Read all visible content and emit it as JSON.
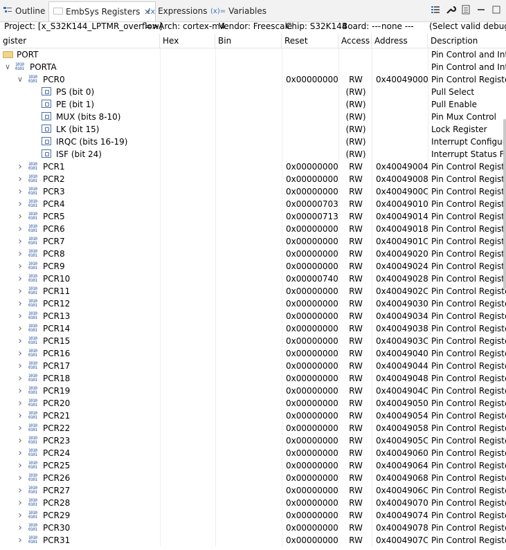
{
  "tabs": [
    {
      "label": "Outline",
      "icon": "outline-icon",
      "active": false
    },
    {
      "label": "EmbSys Registers",
      "icon": "registers-icon",
      "active": true
    },
    {
      "label": "Expressions",
      "icon": "expressions-icon",
      "active": false
    },
    {
      "label": "Variables",
      "icon": "variables-icon",
      "prefix": "(x)=",
      "active": false
    }
  ],
  "toolbar": {
    "icons": [
      "list-icon",
      "wrench-icon",
      "doc-icon",
      "minimize-icon",
      "maximize-icon"
    ]
  },
  "info": {
    "project": "Project: [x_S32K144_LPTMR_overflow]",
    "arch": "=>Arch: cortex-m4",
    "vendor": "Vendor: Freescale",
    "chip": "Chip: S32K144",
    "board": "Board: ---",
    "none": "none ---",
    "select": "(Select valid debug co"
  },
  "columns": {
    "register": "gister",
    "hex": "Hex",
    "bin": "Bin",
    "reset": "Reset",
    "access": "Access",
    "address": "Address",
    "description": "Description"
  },
  "rows": [
    {
      "kind": "group",
      "name": "PORT",
      "desc": "Pin Control and Inte",
      "level": 0
    },
    {
      "kind": "group2",
      "name": "PORTA",
      "desc": "Pin Control and Inte",
      "level": 1,
      "expanded": true
    },
    {
      "kind": "reg",
      "name": "PCR0",
      "reset": "0x00000000",
      "access": "RW",
      "addr": "0x40049000",
      "desc": "Pin Control Register",
      "expanded": true
    },
    {
      "kind": "field",
      "name": "PS (bit 0)",
      "access": "(RW)",
      "desc": "Pull Select"
    },
    {
      "kind": "field",
      "name": "PE (bit 1)",
      "access": "(RW)",
      "desc": "Pull Enable"
    },
    {
      "kind": "field",
      "name": "MUX (bits 8-10)",
      "access": "(RW)",
      "desc": "Pin Mux Control"
    },
    {
      "kind": "field",
      "name": "LK (bit 15)",
      "access": "(RW)",
      "desc": "Lock Register"
    },
    {
      "kind": "field",
      "name": "IRQC (bits 16-19)",
      "access": "(RW)",
      "desc": "Interrupt Configurat"
    },
    {
      "kind": "field",
      "name": "ISF (bit 24)",
      "access": "(RW)",
      "desc": "Interrupt Status Flag"
    },
    {
      "kind": "reg",
      "name": "PCR1",
      "reset": "0x00000000",
      "access": "RW",
      "addr": "0x40049004",
      "desc": "Pin Control Register"
    },
    {
      "kind": "reg",
      "name": "PCR2",
      "reset": "0x00000000",
      "access": "RW",
      "addr": "0x40049008",
      "desc": "Pin Control Register"
    },
    {
      "kind": "reg",
      "name": "PCR3",
      "reset": "0x00000000",
      "access": "RW",
      "addr": "0x4004900C",
      "desc": "Pin Control Register"
    },
    {
      "kind": "reg",
      "name": "PCR4",
      "reset": "0x00000703",
      "access": "RW",
      "addr": "0x40049010",
      "desc": "Pin Control Register"
    },
    {
      "kind": "reg",
      "name": "PCR5",
      "reset": "0x00000713",
      "access": "RW",
      "addr": "0x40049014",
      "desc": "Pin Control Register"
    },
    {
      "kind": "reg",
      "name": "PCR6",
      "reset": "0x00000000",
      "access": "RW",
      "addr": "0x40049018",
      "desc": "Pin Control Register"
    },
    {
      "kind": "reg",
      "name": "PCR7",
      "reset": "0x00000000",
      "access": "RW",
      "addr": "0x4004901C",
      "desc": "Pin Control Register"
    },
    {
      "kind": "reg",
      "name": "PCR8",
      "reset": "0x00000000",
      "access": "RW",
      "addr": "0x40049020",
      "desc": "Pin Control Register"
    },
    {
      "kind": "reg",
      "name": "PCR9",
      "reset": "0x00000000",
      "access": "RW",
      "addr": "0x40049024",
      "desc": "Pin Control Register"
    },
    {
      "kind": "reg",
      "name": "PCR10",
      "reset": "0x00000740",
      "access": "RW",
      "addr": "0x40049028",
      "desc": "Pin Control Register"
    },
    {
      "kind": "reg",
      "name": "PCR11",
      "reset": "0x00000000",
      "access": "RW",
      "addr": "0x4004902C",
      "desc": "Pin Control Register"
    },
    {
      "kind": "reg",
      "name": "PCR12",
      "reset": "0x00000000",
      "access": "RW",
      "addr": "0x40049030",
      "desc": "Pin Control Register"
    },
    {
      "kind": "reg",
      "name": "PCR13",
      "reset": "0x00000000",
      "access": "RW",
      "addr": "0x40049034",
      "desc": "Pin Control Register"
    },
    {
      "kind": "reg",
      "name": "PCR14",
      "reset": "0x00000000",
      "access": "RW",
      "addr": "0x40049038",
      "desc": "Pin Control Register"
    },
    {
      "kind": "reg",
      "name": "PCR15",
      "reset": "0x00000000",
      "access": "RW",
      "addr": "0x4004903C",
      "desc": "Pin Control Register"
    },
    {
      "kind": "reg",
      "name": "PCR16",
      "reset": "0x00000000",
      "access": "RW",
      "addr": "0x40049040",
      "desc": "Pin Control Register"
    },
    {
      "kind": "reg",
      "name": "PCR17",
      "reset": "0x00000000",
      "access": "RW",
      "addr": "0x40049044",
      "desc": "Pin Control Register"
    },
    {
      "kind": "reg",
      "name": "PCR18",
      "reset": "0x00000000",
      "access": "RW",
      "addr": "0x40049048",
      "desc": "Pin Control Register"
    },
    {
      "kind": "reg",
      "name": "PCR19",
      "reset": "0x00000000",
      "access": "RW",
      "addr": "0x4004904C",
      "desc": "Pin Control Register"
    },
    {
      "kind": "reg",
      "name": "PCR20",
      "reset": "0x00000000",
      "access": "RW",
      "addr": "0x40049050",
      "desc": "Pin Control Register"
    },
    {
      "kind": "reg",
      "name": "PCR21",
      "reset": "0x00000000",
      "access": "RW",
      "addr": "0x40049054",
      "desc": "Pin Control Register"
    },
    {
      "kind": "reg",
      "name": "PCR22",
      "reset": "0x00000000",
      "access": "RW",
      "addr": "0x40049058",
      "desc": "Pin Control Register"
    },
    {
      "kind": "reg",
      "name": "PCR23",
      "reset": "0x00000000",
      "access": "RW",
      "addr": "0x4004905C",
      "desc": "Pin Control Register"
    },
    {
      "kind": "reg",
      "name": "PCR24",
      "reset": "0x00000000",
      "access": "RW",
      "addr": "0x40049060",
      "desc": "Pin Control Register"
    },
    {
      "kind": "reg",
      "name": "PCR25",
      "reset": "0x00000000",
      "access": "RW",
      "addr": "0x40049064",
      "desc": "Pin Control Register"
    },
    {
      "kind": "reg",
      "name": "PCR26",
      "reset": "0x00000000",
      "access": "RW",
      "addr": "0x40049068",
      "desc": "Pin Control Register"
    },
    {
      "kind": "reg",
      "name": "PCR27",
      "reset": "0x00000000",
      "access": "RW",
      "addr": "0x4004906C",
      "desc": "Pin Control Register"
    },
    {
      "kind": "reg",
      "name": "PCR28",
      "reset": "0x00000000",
      "access": "RW",
      "addr": "0x40049070",
      "desc": "Pin Control Register"
    },
    {
      "kind": "reg",
      "name": "PCR29",
      "reset": "0x00000000",
      "access": "RW",
      "addr": "0x40049074",
      "desc": "Pin Control Register"
    },
    {
      "kind": "reg",
      "name": "PCR30",
      "reset": "0x00000000",
      "access": "RW",
      "addr": "0x40049078",
      "desc": "Pin Control Register"
    },
    {
      "kind": "reg",
      "name": "PCR31",
      "reset": "0x00000000",
      "access": "RW",
      "addr": "0x4004907C",
      "desc": "Pin Control Register"
    }
  ]
}
